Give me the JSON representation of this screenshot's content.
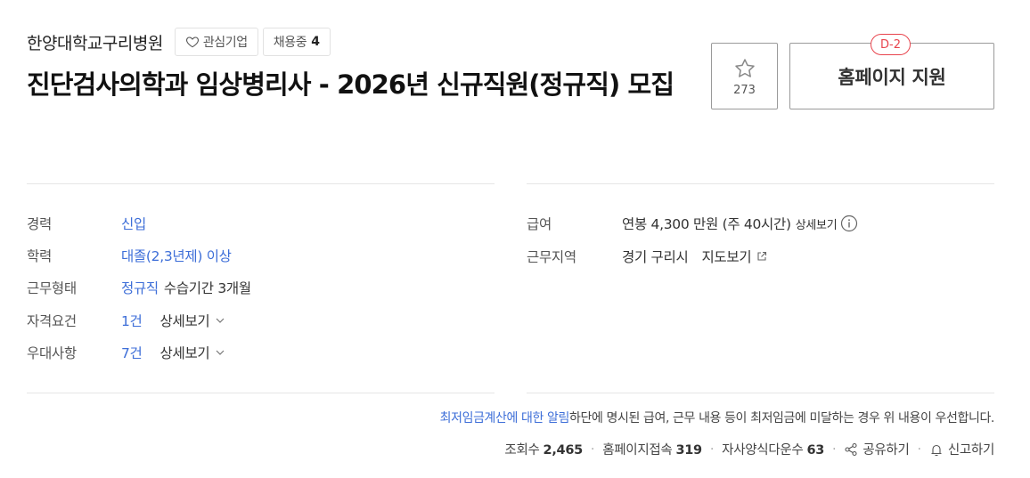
{
  "company": {
    "name": "한양대학교구리병원",
    "favorite_label": "관심기업",
    "hiring_label": "채용중",
    "hiring_count": "4"
  },
  "job": {
    "title": "진단검사의학과 임상병리사 - 2026년 신규직원(정규직) 모집"
  },
  "actions": {
    "scrap_count": "273",
    "apply_label": "홈페이지 지원",
    "dday": "D-2"
  },
  "details_left": {
    "career_label": "경력",
    "career_value": "신입",
    "education_label": "학력",
    "education_value": "대졸(2,3년제) 이상",
    "employment_label": "근무형태",
    "employment_value": "정규직",
    "employment_extra": "수습기간 3개월",
    "qualification_label": "자격요건",
    "qualification_value": "1건",
    "qualification_detail": "상세보기",
    "preference_label": "우대사항",
    "preference_value": "7건",
    "preference_detail": "상세보기"
  },
  "details_right": {
    "salary_label": "급여",
    "salary_value": "연봉 4,300 만원 (주 40시간)",
    "salary_detail": "상세보기",
    "location_label": "근무지역",
    "location_value": "경기 구리시",
    "map_label": "지도보기"
  },
  "notice": {
    "link_text": "최저임금계산에 대한 알림",
    "text": "하단에 명시된 급여, 근무 내용 등이 최저임금에 미달하는 경우 위 내용이 우선합니다."
  },
  "stats": {
    "views_label": "조회수",
    "views": "2,465",
    "homepage_label": "홈페이지접속",
    "homepage": "319",
    "form_label": "자사양식다운수",
    "form": "63",
    "share_label": "공유하기",
    "report_label": "신고하기"
  },
  "colors": {
    "link_blue": "#3d6ed8",
    "dday_red": "#e8444d"
  }
}
